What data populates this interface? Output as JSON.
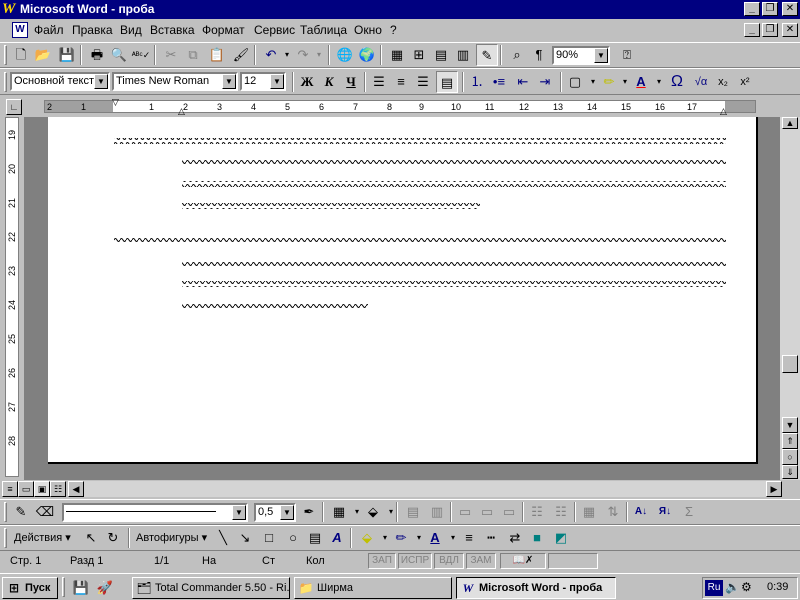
{
  "window": {
    "title": "Microsoft Word - проба",
    "app_icon": "W",
    "controls": [
      "_",
      "❐",
      "✕"
    ]
  },
  "menu": {
    "items": [
      "Файл",
      "Правка",
      "Вид",
      "Вставка",
      "Формат",
      "Сервис",
      "Таблица",
      "Окно",
      "?"
    ],
    "doc_controls": [
      "_",
      "❐",
      "✕"
    ]
  },
  "standard_toolbar": {
    "zoom": "90%"
  },
  "format_toolbar": {
    "style": "Основной текст",
    "font": "Times New Roman",
    "size": "12",
    "bold": "Ж",
    "italic": "К",
    "underline": "Ч",
    "omega": "Ω",
    "sqrt": "√α",
    "subscript": "x₂",
    "superscript": "x²"
  },
  "ruler": {
    "numbers": [
      "2",
      "1",
      "1",
      "2",
      "3",
      "4",
      "5",
      "6",
      "7",
      "8",
      "9",
      "10",
      "11",
      "12",
      "13",
      "14",
      "15",
      "16",
      "17"
    ],
    "vnumbers": [
      "19",
      "20",
      "21",
      "22",
      "23",
      "24",
      "25",
      "26",
      "27",
      "28"
    ]
  },
  "drawing_toolbar": {
    "line_width": "0,5",
    "actions": "Действия",
    "autoshapes": "Автофигуры"
  },
  "status": {
    "page": "Стр.  1",
    "section": "Разд  1",
    "pages": "1/1",
    "at": "На",
    "line": "Ст",
    "col": "Кол",
    "rec": "ЗАП",
    "trk": "ИСПР",
    "ext": "ВДЛ",
    "ovr": "ЗАМ"
  },
  "taskbar": {
    "start": "Пуск",
    "tasks": [
      "Total Commander 5.50 - Ri...",
      "Ширма",
      "Microsoft Word - проба"
    ],
    "lang": "Ru",
    "clock": "0:39"
  },
  "colors": {
    "title_bg": "#000080",
    "face": "#c0c0c0",
    "workspace": "#808080"
  }
}
